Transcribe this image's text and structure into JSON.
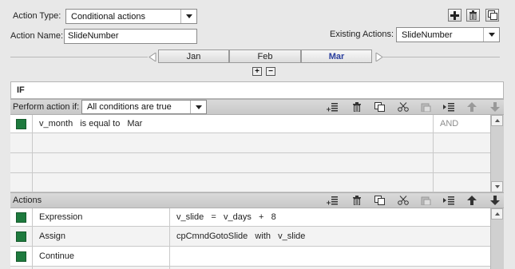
{
  "header": {
    "action_type_label": "Action Type:",
    "action_type_value": "Conditional actions",
    "action_name_label": "Action Name:",
    "action_name_value": "SlideNumber",
    "existing_actions_label": "Existing Actions:",
    "existing_actions_value": "SlideNumber",
    "toolbar_icons": [
      "add-icon",
      "trash-icon",
      "duplicate-icon"
    ]
  },
  "tabs": [
    {
      "label": "Jan",
      "active": false
    },
    {
      "label": "Feb",
      "active": false
    },
    {
      "label": "Mar",
      "active": true
    }
  ],
  "if_section": {
    "title": "IF",
    "perform_label": "Perform action if:",
    "perform_value": "All conditions are true",
    "conditions": [
      {
        "variable": "v_month",
        "operator": "is equal to",
        "value": "Mar",
        "join": "AND"
      }
    ]
  },
  "actions_section": {
    "title": "Actions",
    "rows": [
      {
        "command": "Expression",
        "detail": "v_slide   =   v_days   +   8"
      },
      {
        "command": "Assign",
        "detail": "cpCmndGotoSlide   with   v_slide"
      },
      {
        "command": "Continue",
        "detail": ""
      }
    ]
  },
  "colors": {
    "row_marker": "#1e7a3e",
    "active_tab": "#2b3f9e"
  }
}
